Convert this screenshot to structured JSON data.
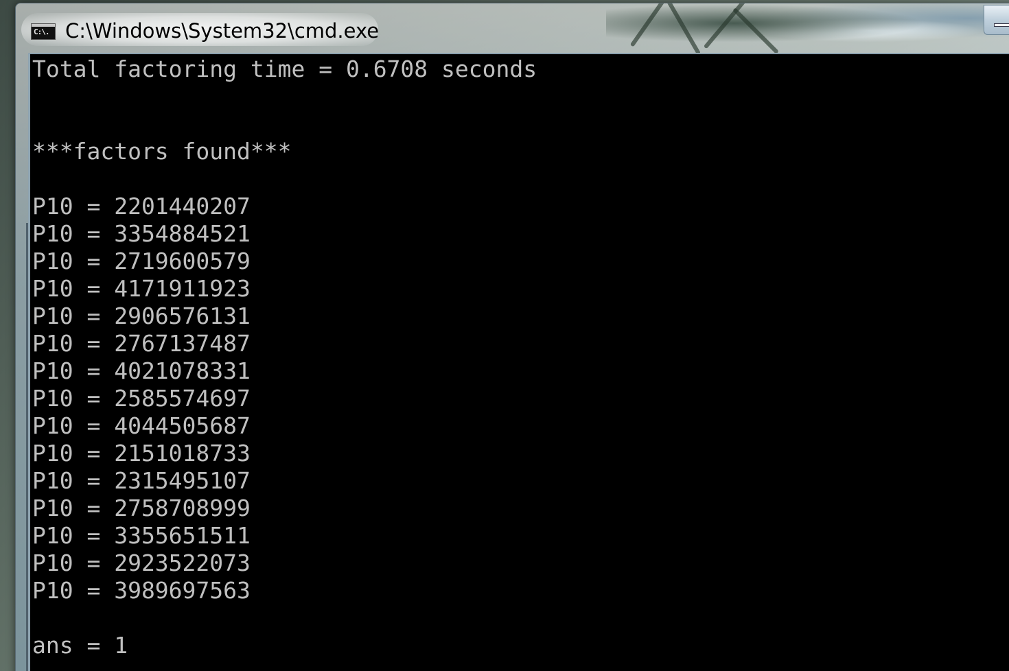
{
  "window": {
    "title": "C:\\Windows\\System32\\cmd.exe",
    "icon": "cmd-icon",
    "icon_text": "C:\\."
  },
  "colors": {
    "console_background": "#000000",
    "console_text": "#c0c0c0"
  },
  "console": {
    "lines": [
      "Total factoring time = 0.6708 seconds",
      "",
      "",
      "***factors found***",
      "",
      "P10 = 2201440207",
      "P10 = 3354884521",
      "P10 = 2719600579",
      "P10 = 4171911923",
      "P10 = 2906576131",
      "P10 = 2767137487",
      "P10 = 4021078331",
      "P10 = 2585574697",
      "P10 = 4044505687",
      "P10 = 2151018733",
      "P10 = 2315495107",
      "P10 = 2758708999",
      "P10 = 3355651511",
      "P10 = 2923522073",
      "P10 = 3989697563",
      "",
      "ans = 1"
    ]
  }
}
